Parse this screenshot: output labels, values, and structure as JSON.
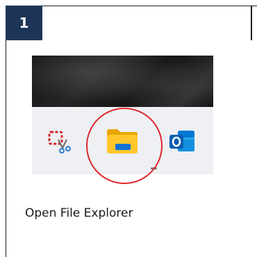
{
  "step": {
    "number": "1"
  },
  "taskbar": {
    "icons": [
      {
        "name": "snipping-tool-icon",
        "label": ""
      },
      {
        "name": "file-explorer-icon",
        "label": ""
      },
      {
        "name": "outlook-icon",
        "label": ""
      }
    ],
    "highlighted_icon": "file-explorer-icon",
    "highlight_color": "#e0262b"
  },
  "caption": {
    "text": "Open File Explorer"
  },
  "colors": {
    "badge": "#1d3557",
    "taskbar": "#eef0f3"
  }
}
